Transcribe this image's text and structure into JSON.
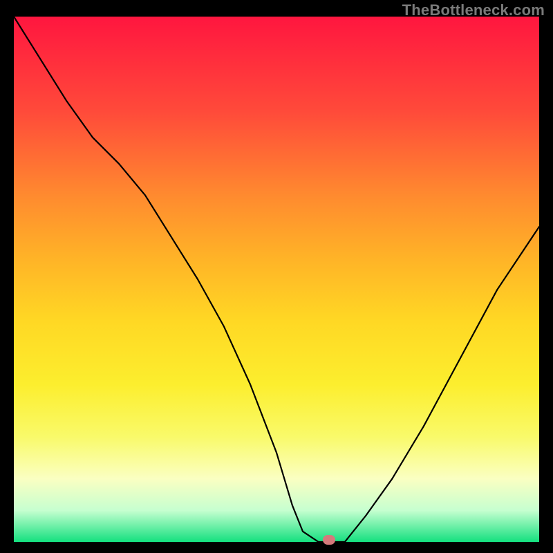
{
  "watermark": "TheBottleneck.com",
  "chart_data": {
    "type": "line",
    "title": "",
    "xlabel": "",
    "ylabel": "",
    "xlim": [
      0,
      100
    ],
    "ylim": [
      0,
      100
    ],
    "grid": false,
    "legend": false,
    "series": [
      {
        "name": "bottleneck-curve",
        "x": [
          0,
          5,
          10,
          15,
          20,
          25,
          30,
          35,
          40,
          45,
          50,
          53,
          55,
          58,
          60,
          63,
          67,
          72,
          78,
          85,
          92,
          100
        ],
        "y": [
          100,
          92,
          84,
          77,
          72,
          66,
          58,
          50,
          41,
          30,
          17,
          7,
          2,
          0,
          0,
          0,
          5,
          12,
          22,
          35,
          48,
          60
        ]
      }
    ],
    "marker": {
      "x": 60,
      "y": 0,
      "color": "#d57a7c"
    },
    "background_gradient": {
      "top": "#ff163f",
      "mid": "#ffd824",
      "bottom": "#14e07f"
    }
  }
}
